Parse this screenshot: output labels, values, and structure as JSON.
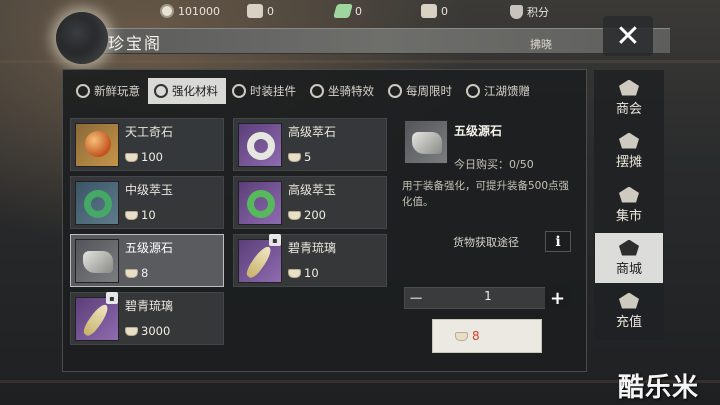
{
  "header": {
    "title": "珍宝阁",
    "subtitle": "拂晓",
    "close_label": "✕"
  },
  "resources": [
    {
      "icon": "coin-icon",
      "value": "101000"
    },
    {
      "icon": "ingot-icon",
      "value": "0"
    },
    {
      "icon": "jade-ticket-icon",
      "value": "0"
    },
    {
      "icon": "silver-ingot-icon",
      "value": "0"
    },
    {
      "icon": "shield-points-icon",
      "value": "积分"
    }
  ],
  "tabs": [
    {
      "label": "新鲜玩意",
      "active": false
    },
    {
      "label": "强化材料",
      "active": true
    },
    {
      "label": "时装挂件",
      "active": false
    },
    {
      "label": "坐骑特效",
      "active": false
    },
    {
      "label": "每周限时",
      "active": false
    },
    {
      "label": "江湖馈赠",
      "active": false
    }
  ],
  "items": [
    {
      "name": "天工奇石",
      "price": "100",
      "icon": "orb-icon"
    },
    {
      "name": "高级萃石",
      "price": "5",
      "icon": "white-ring-icon"
    },
    {
      "name": "中级萃玉",
      "price": "10",
      "icon": "green-ring-icon"
    },
    {
      "name": "高级萃玉",
      "price": "200",
      "icon": "bright-green-ring-icon"
    },
    {
      "name": "五级源石",
      "price": "8",
      "icon": "rock-icon",
      "selected": true
    },
    {
      "name": "碧青琉璃",
      "price": "10",
      "icon": "feather-icon",
      "locked": true
    },
    {
      "name": "碧青琉璃",
      "price": "3000",
      "icon": "feather-icon",
      "locked": true
    }
  ],
  "detail": {
    "name": "五级源石",
    "limit": "今日购买：0/50",
    "description": "用于装备强化，可提升装备500点强化值。",
    "source_label": "货物获取途径",
    "info_label": "i",
    "quantity": "1",
    "minus_label": "−",
    "plus_label": "+",
    "buy_price": "8"
  },
  "nav": [
    {
      "label": "商会",
      "active": false
    },
    {
      "label": "摆摊",
      "active": false
    },
    {
      "label": "集市",
      "active": false
    },
    {
      "label": "商城",
      "active": true
    },
    {
      "label": "充值",
      "active": false
    }
  ],
  "watermark": "酷乐米"
}
